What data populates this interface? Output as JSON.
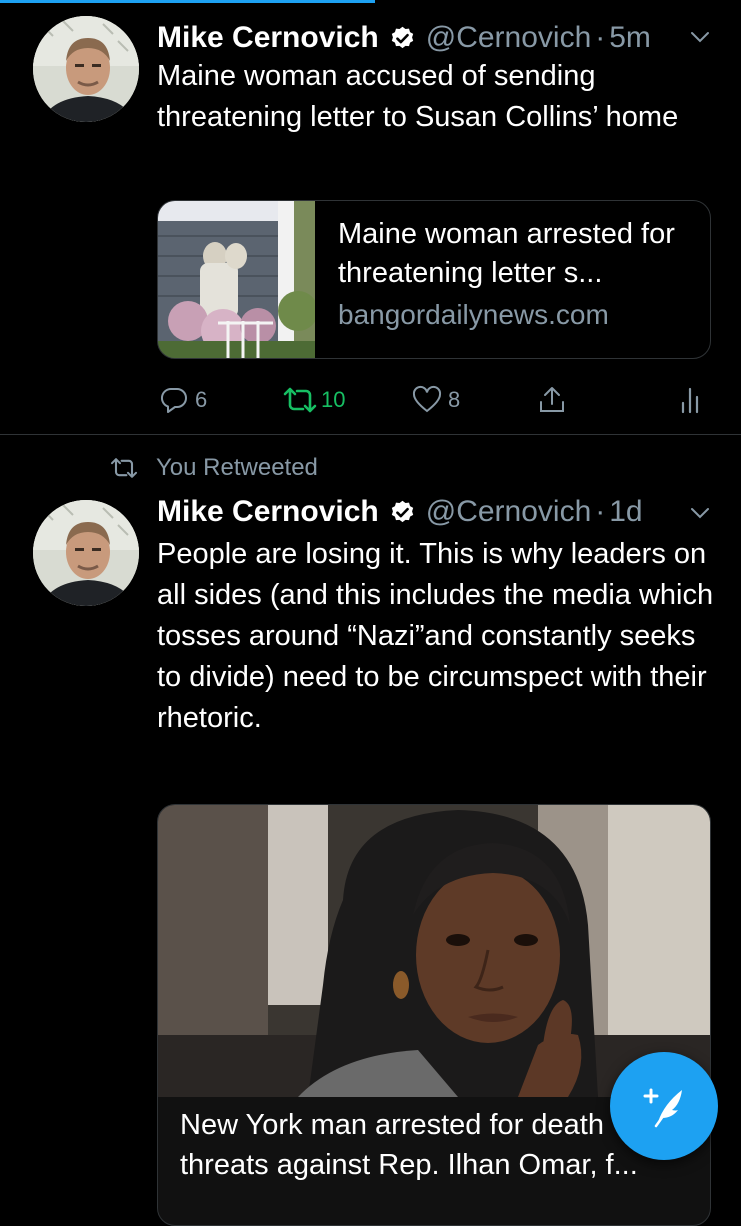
{
  "colors": {
    "accent": "#1da1f2",
    "retweet_active": "#17bf63",
    "muted": "#8899a6",
    "background": "#000000"
  },
  "tweets": [
    {
      "author_name": "Mike Cernovich",
      "handle": "@Cernovich",
      "separator": "·",
      "time": "5m",
      "text": "Maine woman accused of sending threatening letter to Susan Collins’ home",
      "card": {
        "title": "Maine woman arrested for threatening letter s...",
        "domain": "bangordailynews.com"
      },
      "actions": {
        "replies": "6",
        "retweets": "10",
        "likes": "8"
      },
      "retweeted_by_you": true
    },
    {
      "context": "You Retweeted",
      "author_name": "Mike Cernovich",
      "handle": "@Cernovich",
      "separator": "·",
      "time": "1d",
      "text": "People are losing it. This is why leaders on all sides (and this includes the media which tosses around “Nazi”and constantly seeks to divide) need to be circumspect with their rhetoric.",
      "card": {
        "title": "New York man arrested for death threats against Rep. Ilhan Omar, f..."
      }
    }
  ],
  "icons": {
    "verified": "verified-badge-icon",
    "chevron": "chevron-down-icon",
    "reply": "reply-icon",
    "retweet": "retweet-icon",
    "like": "heart-icon",
    "share": "share-icon",
    "analytics": "analytics-icon",
    "compose": "compose-tweet-icon"
  }
}
